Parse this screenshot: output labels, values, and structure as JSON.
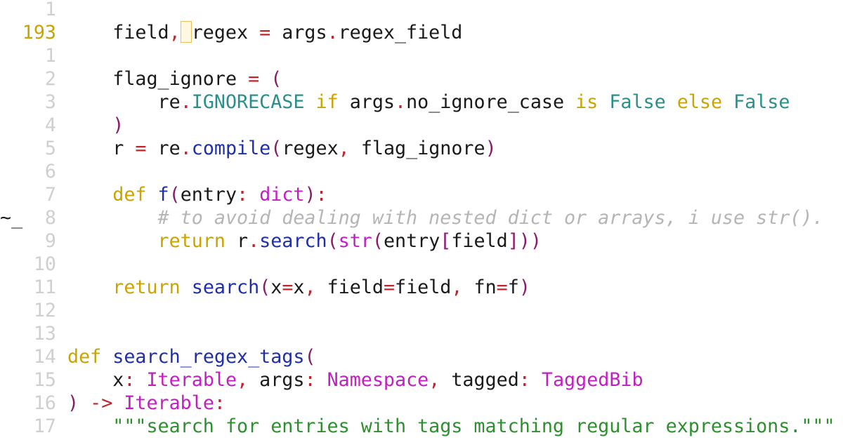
{
  "editor": {
    "colors": {
      "text": "#1a1a1a",
      "line_number": "#cfcfcf",
      "current_line_number": "#c9a400",
      "keyword": "#c9a400",
      "operator": "#c0242c",
      "builtin": "#2a8f8a",
      "function": "#1f2fa8",
      "type": "#c21fc2",
      "paren": "#8a1a6b",
      "comment": "#b5b5b5",
      "string": "#2e8f2e",
      "cursor": "#e8c15a"
    },
    "lines": [
      {
        "num": "1",
        "sign": "",
        "current": false,
        "tokens": []
      },
      {
        "num": "193",
        "sign": "",
        "current": true,
        "tokens": [
          {
            "t": "    field",
            "c": "text"
          },
          {
            "t": ",",
            "c": "operator"
          },
          {
            "t": "CURSOR",
            "c": "cursor"
          },
          {
            "t": "regex ",
            "c": "text"
          },
          {
            "t": "=",
            "c": "operator"
          },
          {
            "t": " args",
            "c": "text"
          },
          {
            "t": ".",
            "c": "operator"
          },
          {
            "t": "regex_field",
            "c": "text"
          }
        ]
      },
      {
        "num": "1",
        "sign": "",
        "current": false,
        "tokens": []
      },
      {
        "num": "2",
        "sign": "",
        "current": false,
        "tokens": [
          {
            "t": "    flag_ignore ",
            "c": "text"
          },
          {
            "t": "=",
            "c": "operator"
          },
          {
            "t": " ",
            "c": "text"
          },
          {
            "t": "(",
            "c": "paren"
          }
        ]
      },
      {
        "num": "3",
        "sign": "",
        "current": false,
        "tokens": [
          {
            "t": "        re",
            "c": "text"
          },
          {
            "t": ".",
            "c": "operator"
          },
          {
            "t": "IGNORECASE",
            "c": "builtin"
          },
          {
            "t": " if ",
            "c": "keyword"
          },
          {
            "t": "args",
            "c": "text"
          },
          {
            "t": ".",
            "c": "operator"
          },
          {
            "t": "no_ignore_case",
            "c": "text"
          },
          {
            "t": " is ",
            "c": "keyword"
          },
          {
            "t": "False",
            "c": "builtin"
          },
          {
            "t": " else ",
            "c": "keyword"
          },
          {
            "t": "False",
            "c": "builtin"
          }
        ]
      },
      {
        "num": "4",
        "sign": "",
        "current": false,
        "tokens": [
          {
            "t": "    ",
            "c": "text"
          },
          {
            "t": ")",
            "c": "paren"
          }
        ]
      },
      {
        "num": "5",
        "sign": "",
        "current": false,
        "tokens": [
          {
            "t": "    r ",
            "c": "text"
          },
          {
            "t": "=",
            "c": "operator"
          },
          {
            "t": " re",
            "c": "text"
          },
          {
            "t": ".",
            "c": "operator"
          },
          {
            "t": "compile",
            "c": "function"
          },
          {
            "t": "(",
            "c": "paren"
          },
          {
            "t": "regex",
            "c": "text"
          },
          {
            "t": ",",
            "c": "operator"
          },
          {
            "t": " flag_ignore",
            "c": "text"
          },
          {
            "t": ")",
            "c": "paren"
          }
        ]
      },
      {
        "num": "6",
        "sign": "",
        "current": false,
        "tokens": []
      },
      {
        "num": "7",
        "sign": "",
        "current": false,
        "tokens": [
          {
            "t": "    def ",
            "c": "keyword"
          },
          {
            "t": "f",
            "c": "function"
          },
          {
            "t": "(",
            "c": "paren"
          },
          {
            "t": "entry",
            "c": "text"
          },
          {
            "t": ":",
            "c": "operator"
          },
          {
            "t": " dict",
            "c": "type"
          },
          {
            "t": ")",
            "c": "paren"
          },
          {
            "t": ":",
            "c": "operator"
          }
        ]
      },
      {
        "num": "8",
        "sign": "~_",
        "current": false,
        "tokens": [
          {
            "t": "        # to avoid dealing with nested dict or arrays, i use str().",
            "c": "comment"
          }
        ]
      },
      {
        "num": "9",
        "sign": "",
        "current": false,
        "tokens": [
          {
            "t": "        return ",
            "c": "keyword"
          },
          {
            "t": "r",
            "c": "text"
          },
          {
            "t": ".",
            "c": "operator"
          },
          {
            "t": "search",
            "c": "function"
          },
          {
            "t": "(",
            "c": "paren"
          },
          {
            "t": "str",
            "c": "type"
          },
          {
            "t": "(",
            "c": "paren"
          },
          {
            "t": "entry",
            "c": "text"
          },
          {
            "t": "[",
            "c": "paren"
          },
          {
            "t": "field",
            "c": "text"
          },
          {
            "t": "]))",
            "c": "paren"
          }
        ]
      },
      {
        "num": "10",
        "sign": "",
        "current": false,
        "tokens": []
      },
      {
        "num": "11",
        "sign": "",
        "current": false,
        "tokens": [
          {
            "t": "    return ",
            "c": "keyword"
          },
          {
            "t": "search",
            "c": "function"
          },
          {
            "t": "(",
            "c": "paren"
          },
          {
            "t": "x",
            "c": "text"
          },
          {
            "t": "=",
            "c": "operator"
          },
          {
            "t": "x",
            "c": "text"
          },
          {
            "t": ",",
            "c": "operator"
          },
          {
            "t": " field",
            "c": "text"
          },
          {
            "t": "=",
            "c": "operator"
          },
          {
            "t": "field",
            "c": "text"
          },
          {
            "t": ",",
            "c": "operator"
          },
          {
            "t": " fn",
            "c": "text"
          },
          {
            "t": "=",
            "c": "operator"
          },
          {
            "t": "f",
            "c": "text"
          },
          {
            "t": ")",
            "c": "paren"
          }
        ]
      },
      {
        "num": "12",
        "sign": "",
        "current": false,
        "tokens": []
      },
      {
        "num": "13",
        "sign": "",
        "current": false,
        "tokens": []
      },
      {
        "num": "14",
        "sign": "",
        "current": false,
        "tokens": [
          {
            "t": "def ",
            "c": "keyword"
          },
          {
            "t": "search_regex_tags",
            "c": "function"
          },
          {
            "t": "(",
            "c": "paren"
          }
        ]
      },
      {
        "num": "15",
        "sign": "",
        "current": false,
        "tokens": [
          {
            "t": "    x",
            "c": "text"
          },
          {
            "t": ":",
            "c": "operator"
          },
          {
            "t": " Iterable",
            "c": "type"
          },
          {
            "t": ",",
            "c": "operator"
          },
          {
            "t": " args",
            "c": "text"
          },
          {
            "t": ":",
            "c": "operator"
          },
          {
            "t": " Namespace",
            "c": "type"
          },
          {
            "t": ",",
            "c": "operator"
          },
          {
            "t": " tagged",
            "c": "text"
          },
          {
            "t": ":",
            "c": "operator"
          },
          {
            "t": " TaggedBib",
            "c": "type"
          }
        ]
      },
      {
        "num": "16",
        "sign": "",
        "current": false,
        "tokens": [
          {
            "t": ")",
            "c": "paren"
          },
          {
            "t": " ->",
            "c": "operator"
          },
          {
            "t": " Iterable",
            "c": "type"
          },
          {
            "t": ":",
            "c": "operator"
          }
        ]
      },
      {
        "num": "17",
        "sign": "",
        "current": false,
        "tokens": [
          {
            "t": "    \"\"\"search for entries with tags matching regular expressions.\"\"\"",
            "c": "string"
          }
        ]
      }
    ]
  }
}
